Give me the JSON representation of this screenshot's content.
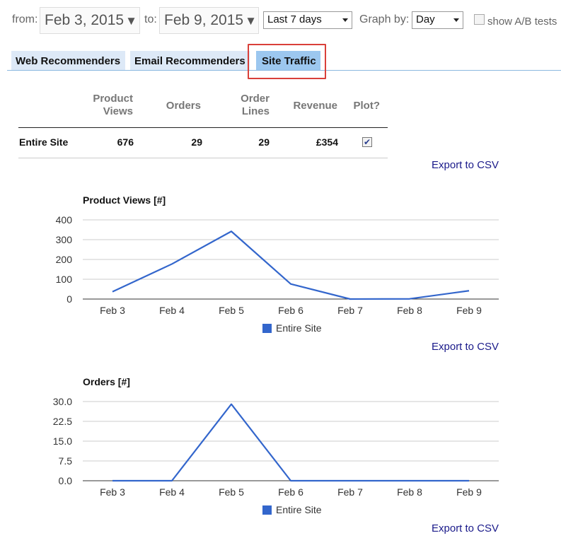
{
  "filters": {
    "from_label": "from:",
    "from_date": "Feb 3, 2015",
    "to_label": "to:",
    "to_date": "Feb 9, 2015",
    "range_value": "Last 7 days",
    "graph_by_label": "Graph by:",
    "graph_by_value": "Day",
    "ab_label": "show A/B tests",
    "ab_checked": false
  },
  "tabs": [
    {
      "label": "Web Recommenders",
      "active": false
    },
    {
      "label": "Email Recommenders",
      "active": false
    },
    {
      "label": "Site Traffic",
      "active": true
    }
  ],
  "summary": {
    "headers": {
      "product_views": [
        "Product",
        "Views"
      ],
      "orders": "Orders",
      "order_lines": [
        "Order",
        "Lines"
      ],
      "revenue": "Revenue",
      "plot": "Plot?"
    },
    "row": {
      "name": "Entire Site",
      "product_views": "676",
      "orders": "29",
      "order_lines": "29",
      "revenue": "£354",
      "plot_checked": true
    }
  },
  "export_label": "Export to CSV",
  "colors": {
    "accent": "#3366cc",
    "tab_active": "#9cc7ef",
    "tab_inactive": "#dde9f7",
    "link": "#1a1a8a",
    "highlight": "#d9403a"
  },
  "chart_data": [
    {
      "type": "line",
      "title": "Product Views [#]",
      "categories": [
        "Feb 3",
        "Feb 4",
        "Feb 5",
        "Feb 6",
        "Feb 7",
        "Feb 8",
        "Feb 9"
      ],
      "series": [
        {
          "name": "Entire Site",
          "values": [
            37,
            177,
            342,
            76,
            0,
            1,
            42
          ]
        }
      ],
      "ylim": [
        0,
        400
      ],
      "yticks": [
        "0",
        "100",
        "200",
        "300",
        "400"
      ],
      "ytick_values": [
        0,
        100,
        200,
        300,
        400
      ],
      "grid": true,
      "legend": "bottom"
    },
    {
      "type": "line",
      "title": "Orders [#]",
      "categories": [
        "Feb 3",
        "Feb 4",
        "Feb 5",
        "Feb 6",
        "Feb 7",
        "Feb 8",
        "Feb 9"
      ],
      "series": [
        {
          "name": "Entire Site",
          "values": [
            0,
            0,
            29,
            0,
            0,
            0,
            0
          ]
        }
      ],
      "ylim": [
        0,
        30
      ],
      "yticks": [
        "0.0",
        "7.5",
        "15.0",
        "22.5",
        "30.0"
      ],
      "ytick_values": [
        0,
        7.5,
        15,
        22.5,
        30
      ],
      "grid": true,
      "legend": "bottom"
    }
  ]
}
